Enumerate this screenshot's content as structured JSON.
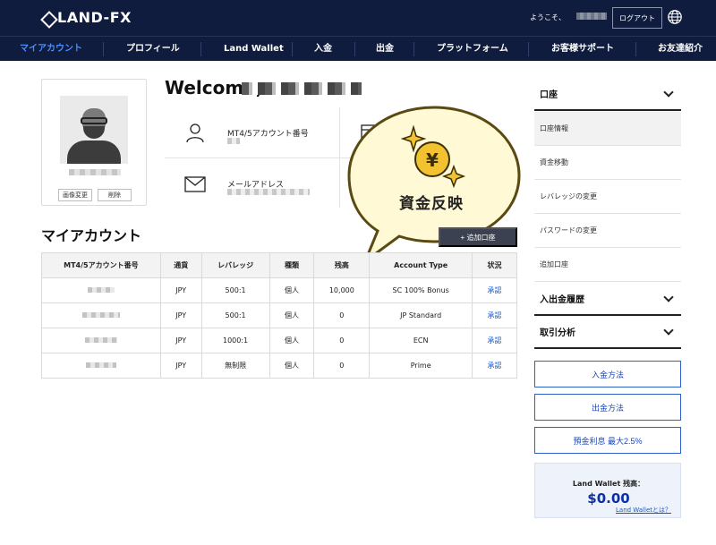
{
  "header": {
    "logo": "LAND-FX",
    "greeting": "ようこそ、",
    "logout_label": "ログアウト"
  },
  "nav": {
    "items": [
      {
        "label": "マイアカウント",
        "active": true
      },
      {
        "label": "プロフィール"
      },
      {
        "label": "Land Wallet"
      },
      {
        "label": "入金"
      },
      {
        "label": "出金"
      },
      {
        "label": "プラットフォーム"
      },
      {
        "label": "お客様サポート"
      },
      {
        "label": "お友達紹介"
      }
    ]
  },
  "profile": {
    "change_image_label": "画像変更",
    "delete_label": "削除"
  },
  "welcome": {
    "title": "Welcome,"
  },
  "info": {
    "account_number_label": "MT4/5アカウント番号",
    "email_label": "メールアドレス"
  },
  "callout": {
    "text": "資金反映"
  },
  "accounts": {
    "title": "マイアカウント",
    "add_label": "+ 追加口座",
    "columns": [
      "MT4/5アカウント番号",
      "通貨",
      "レバレッジ",
      "種類",
      "残高",
      "Account Type",
      "状況"
    ],
    "rows": [
      {
        "currency": "JPY",
        "leverage": "500:1",
        "kind": "個人",
        "balance": "10,000",
        "type": "SC 100% Bonus",
        "status": "承認"
      },
      {
        "currency": "JPY",
        "leverage": "500:1",
        "kind": "個人",
        "balance": "0",
        "type": "JP Standard",
        "status": "承認"
      },
      {
        "currency": "JPY",
        "leverage": "1000:1",
        "kind": "個人",
        "balance": "0",
        "type": "ECN",
        "status": "承認"
      },
      {
        "currency": "JPY",
        "leverage": "無制限",
        "kind": "個人",
        "balance": "0",
        "type": "Prime",
        "status": "承認"
      }
    ]
  },
  "sidebar": {
    "section1": "口座",
    "items": [
      "口座情報",
      "資金移動",
      "レバレッジの変更",
      "パスワードの変更",
      "追加口座"
    ],
    "section2": "入出金履歴",
    "section3": "取引分析",
    "buttons": [
      "入金方法",
      "出金方法",
      "預金利息 最大2.5%"
    ],
    "wallet": {
      "label": "Land Wallet 残高：",
      "value": "$0.00",
      "link": "Land Walletとは？"
    }
  },
  "colors": {
    "header_bg": "#0f1c3d",
    "active_nav": "#4a8cff",
    "link": "#1a56c8",
    "wallet_value": "#0e2fa8"
  }
}
